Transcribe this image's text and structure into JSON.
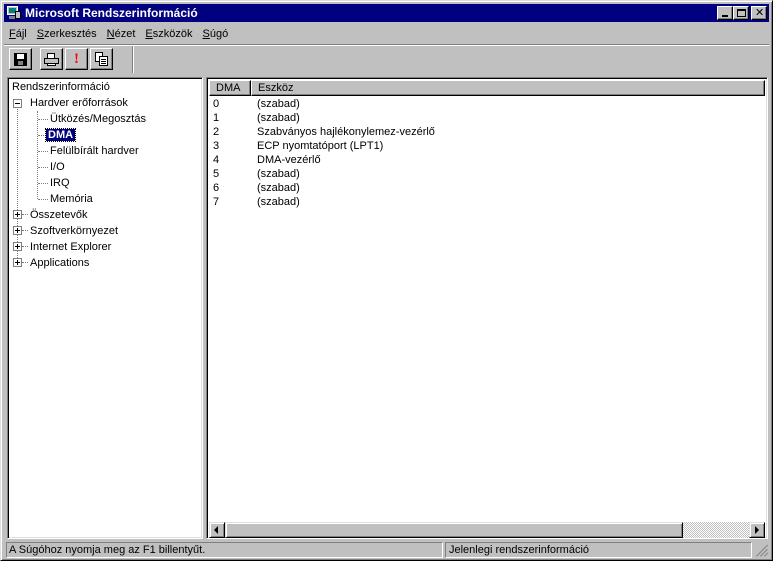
{
  "window": {
    "title": "Microsoft Rendszerinformáció"
  },
  "menu": {
    "items": [
      {
        "prefix": "",
        "accel": "F",
        "rest": "ájl"
      },
      {
        "prefix": "",
        "accel": "S",
        "rest": "zerkesztés"
      },
      {
        "prefix": "",
        "accel": "N",
        "rest": "ézet"
      },
      {
        "prefix": "",
        "accel": "E",
        "rest": "szközök"
      },
      {
        "prefix": "",
        "accel": "S",
        "rest": "úgó"
      }
    ]
  },
  "toolbar": {
    "icons": [
      "save-icon",
      "print-icon",
      "exclamation-icon",
      "copy-icon"
    ]
  },
  "tree": {
    "root": "Rendszerinformáció",
    "hardware": "Hardver erőforrások",
    "conflicts": "Ütközés/Megosztás",
    "dma": "DMA",
    "forced": "Felülbírált hardver",
    "io": "I/O",
    "irq": "IRQ",
    "memory": "Memória",
    "components": "Összetevők",
    "software": "Szoftverkörnyezet",
    "ie": "Internet Explorer",
    "apps": "Applications"
  },
  "list": {
    "headers": {
      "dma": "DMA",
      "device": "Eszköz"
    },
    "rows": [
      {
        "dma": "0",
        "device": "(szabad)"
      },
      {
        "dma": "1",
        "device": "(szabad)"
      },
      {
        "dma": "2",
        "device": "Szabványos hajlékonylemez-vezérlő"
      },
      {
        "dma": "3",
        "device": "ECP nyomtatóport (LPT1)"
      },
      {
        "dma": "4",
        "device": "DMA-vezérlő"
      },
      {
        "dma": "5",
        "device": "(szabad)"
      },
      {
        "dma": "6",
        "device": "(szabad)"
      },
      {
        "dma": "7",
        "device": "(szabad)"
      }
    ]
  },
  "status": {
    "help": "A Súgóhoz nyomja meg az F1 billentyűt.",
    "current": "Jelenlegi rendszerinformáció"
  }
}
